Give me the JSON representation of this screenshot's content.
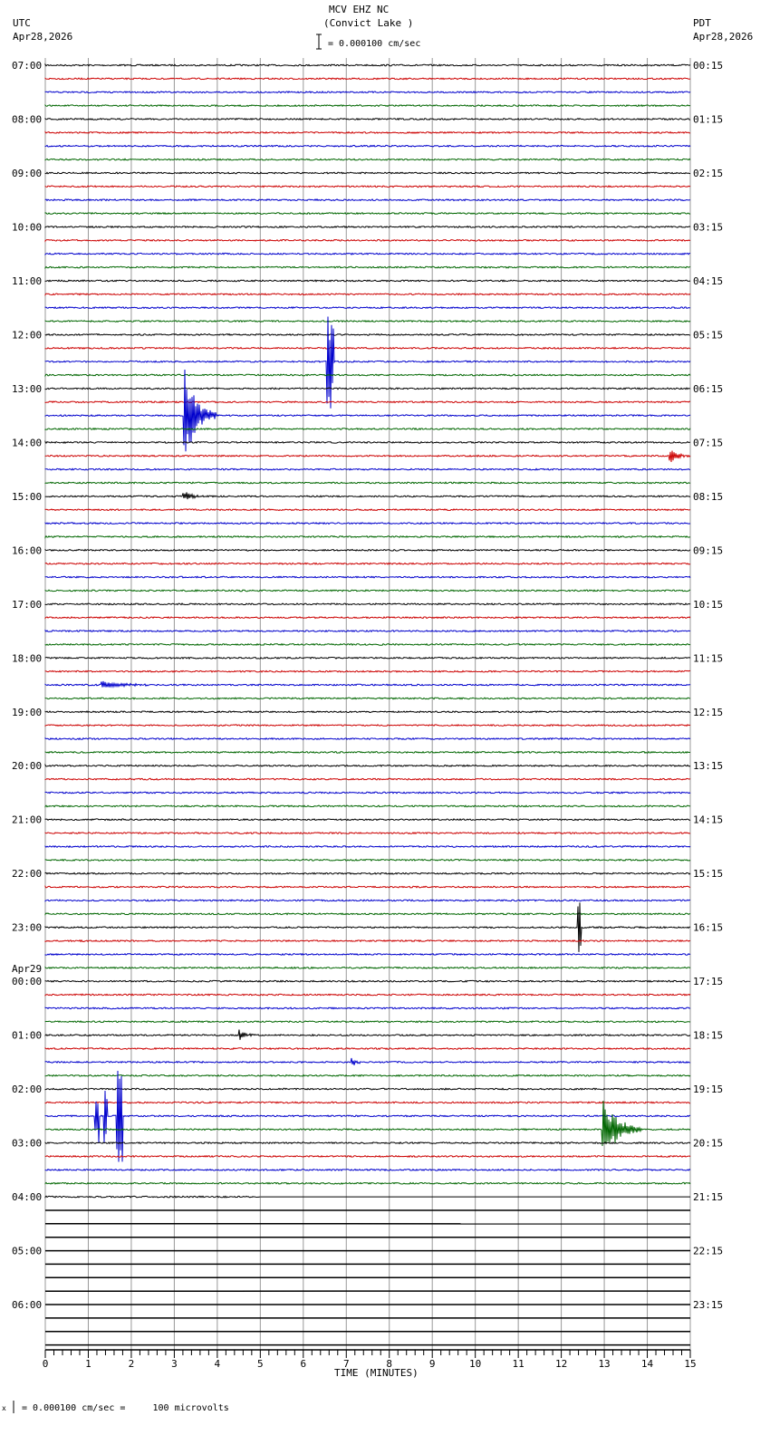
{
  "header": {
    "station": "MCV EHZ NC",
    "location": "(Convict Lake )",
    "left_tz": "UTC",
    "left_date": "Apr28,2026",
    "right_tz": "PDT",
    "right_date": "Apr28,2026",
    "scale_text": "= 0.000100 cm/sec"
  },
  "footer": {
    "scale_text": "= 0.000100 cm/sec =     100 microvolts",
    "prefix": "x"
  },
  "chart_data": {
    "type": "line",
    "title": "MCV EHZ NC (Convict Lake )",
    "xlabel": "TIME (MINUTES)",
    "xlim": [
      0,
      15
    ],
    "x_ticks": [
      "0",
      "1",
      "2",
      "3",
      "4",
      "5",
      "6",
      "7",
      "8",
      "9",
      "10",
      "11",
      "12",
      "13",
      "14",
      "15"
    ],
    "rows_per_hour": 4,
    "total_rows": 96,
    "rows_with_data": 85,
    "last_row_data_until_minute": 5,
    "trace_colors": [
      "#000000",
      "#cc0000",
      "#0000cc",
      "#006600"
    ],
    "left_labels": [
      "07:00",
      "08:00",
      "09:00",
      "10:00",
      "11:00",
      "12:00",
      "13:00",
      "14:00",
      "15:00",
      "16:00",
      "17:00",
      "18:00",
      "19:00",
      "20:00",
      "21:00",
      "22:00",
      "23:00",
      "00:00",
      "01:00",
      "02:00",
      "03:00",
      "04:00",
      "05:00",
      "06:00"
    ],
    "date_change_label": "Apr29",
    "right_labels": [
      "00:15",
      "01:15",
      "02:15",
      "03:15",
      "04:15",
      "05:15",
      "06:15",
      "07:15",
      "08:15",
      "09:15",
      "10:15",
      "11:15",
      "12:15",
      "13:15",
      "14:15",
      "15:15",
      "16:15",
      "17:15",
      "18:15",
      "19:15",
      "20:15",
      "21:15",
      "22:15",
      "23:15"
    ],
    "events": [
      {
        "row": 22,
        "minute": 6.55,
        "duration": 0.1,
        "amplitude": 3.5,
        "kind": "spike"
      },
      {
        "row": 26,
        "minute": 3.22,
        "duration": 0.7,
        "amplitude": 4,
        "kind": "quake"
      },
      {
        "row": 29,
        "minute": 14.5,
        "duration": 0.5,
        "amplitude": 0.6,
        "kind": "quake"
      },
      {
        "row": 32,
        "minute": 3.2,
        "duration": 0.5,
        "amplitude": 0.4,
        "kind": "quake"
      },
      {
        "row": 46,
        "minute": 1.3,
        "duration": 1.3,
        "amplitude": 0.3,
        "kind": "quake"
      },
      {
        "row": 64,
        "minute": 12.37,
        "duration": 0.05,
        "amplitude": 2.3,
        "kind": "spike"
      },
      {
        "row": 72,
        "minute": 4.5,
        "duration": 0.3,
        "amplitude": 0.5,
        "kind": "quake"
      },
      {
        "row": 74,
        "minute": 7.1,
        "duration": 0.3,
        "amplitude": 0.4,
        "kind": "quake"
      },
      {
        "row": 78,
        "minute": 1.15,
        "duration": 0.05,
        "amplitude": 2.2,
        "kind": "spike"
      },
      {
        "row": 78,
        "minute": 1.35,
        "duration": 0.05,
        "amplitude": 2.0,
        "kind": "spike"
      },
      {
        "row": 78,
        "minute": 1.65,
        "duration": 0.1,
        "amplitude": 3.5,
        "kind": "spike"
      },
      {
        "row": 79,
        "minute": 12.95,
        "duration": 0.9,
        "amplitude": 2.5,
        "kind": "quake"
      }
    ]
  }
}
